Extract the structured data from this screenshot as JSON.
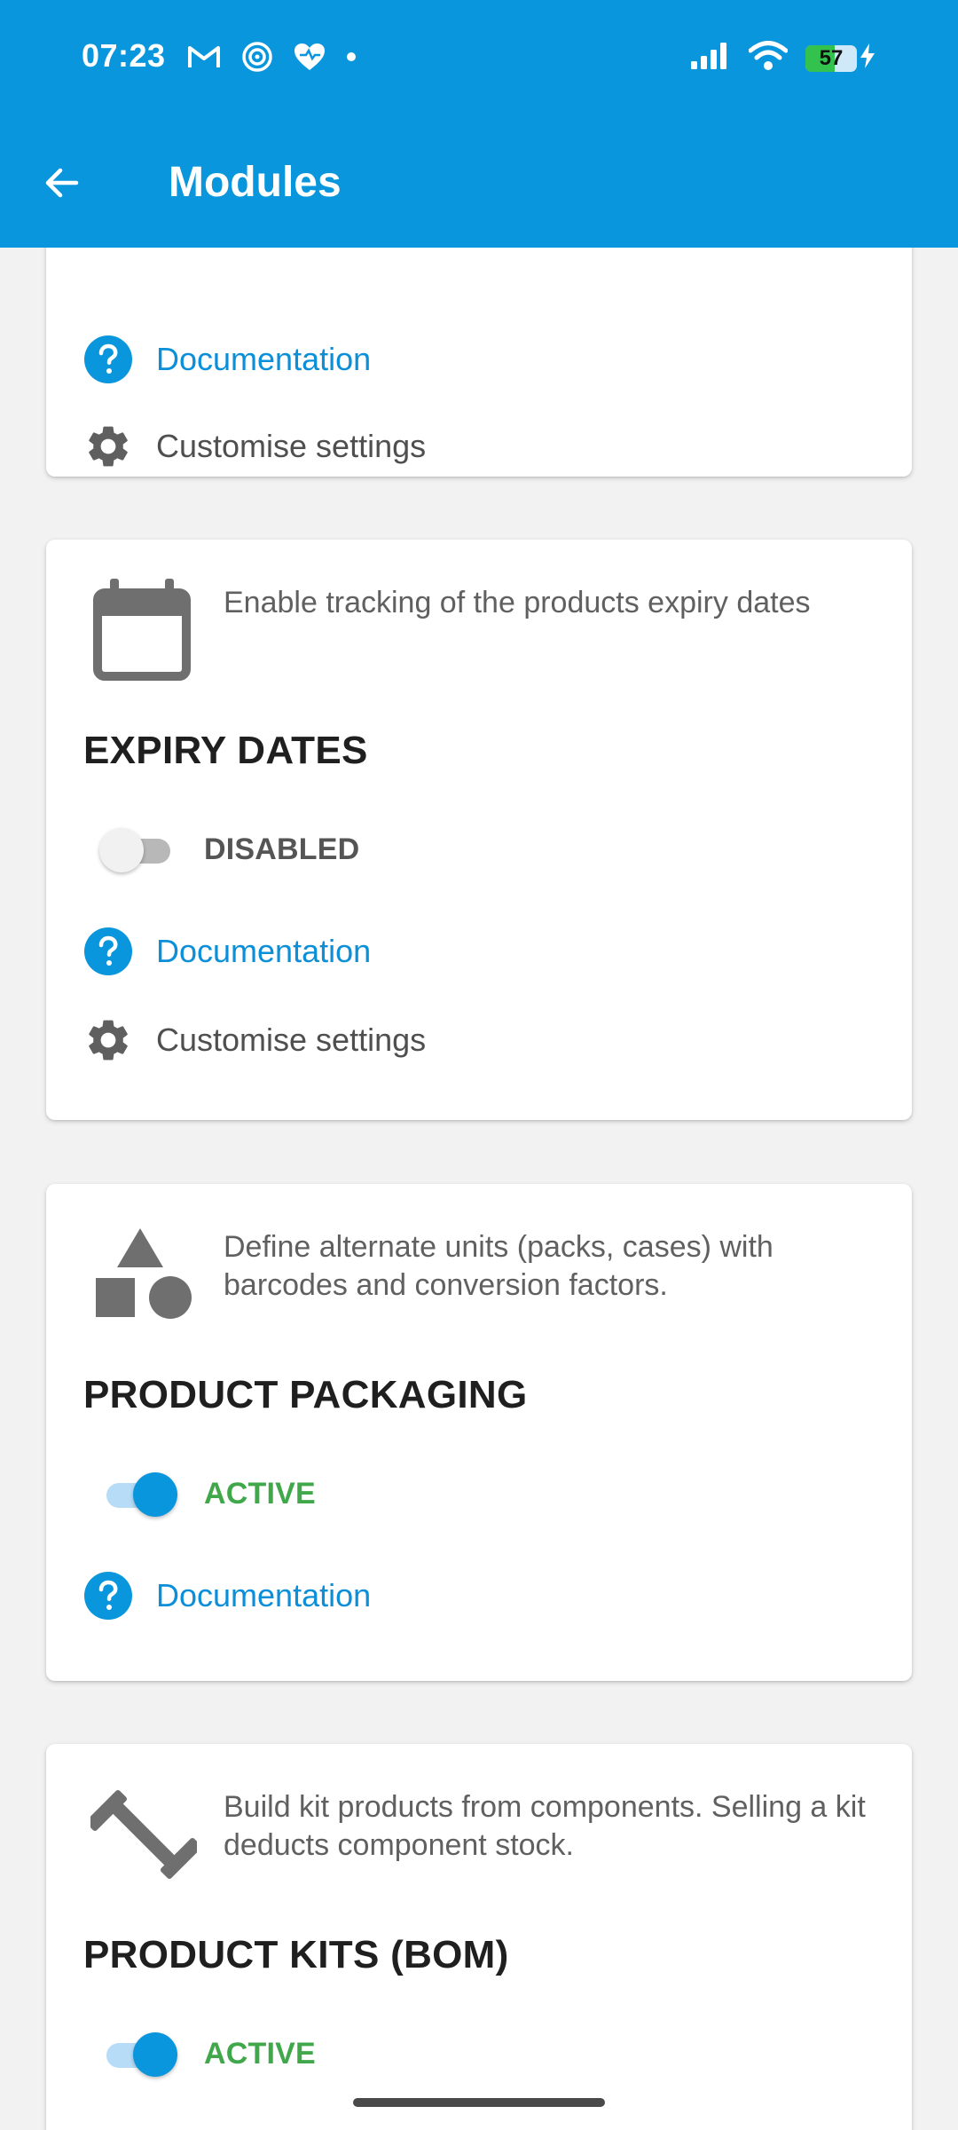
{
  "status_bar": {
    "time": "07:23",
    "battery_percent": 57,
    "icons": [
      "gmail-icon",
      "sync-icon",
      "health-icon",
      "dot-icon",
      "signal-icon",
      "wifi-icon",
      "battery-icon",
      "charging-icon"
    ]
  },
  "app_bar": {
    "title": "Modules",
    "back_icon": "arrow-left-icon"
  },
  "cards": [
    {
      "documentation_label": "Documentation",
      "settings_label": "Customise settings"
    },
    {
      "icon": "calendar-icon",
      "description": "Enable tracking of the products expiry dates",
      "title": "EXPIRY DATES",
      "toggle_state": "off",
      "status_label": "DISABLED",
      "documentation_label": "Documentation",
      "settings_label": "Customise settings"
    },
    {
      "icon": "shapes-icon",
      "description": "Define alternate units (packs, cases) with barcodes and conversion factors.",
      "title": "PRODUCT PACKAGING",
      "toggle_state": "on",
      "status_label": "ACTIVE",
      "documentation_label": "Documentation"
    },
    {
      "icon": "tools-icon",
      "description": "Build kit products from components. Selling a kit deducts component stock.",
      "title": "PRODUCT KITS (BOM)",
      "toggle_state": "on",
      "status_label": "ACTIVE"
    }
  ],
  "colors": {
    "primary": "#0a96dc",
    "active_green": "#40a84a",
    "muted_gray": "#757575"
  }
}
